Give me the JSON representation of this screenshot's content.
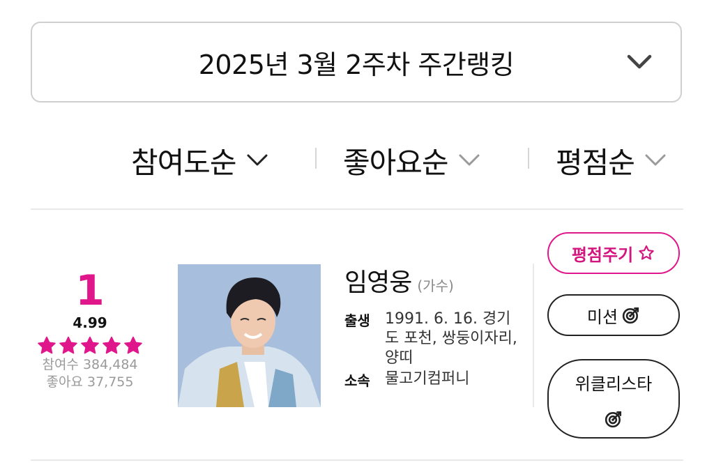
{
  "week_selector": {
    "label": "2025년 3월 2주차 주간랭킹"
  },
  "sort_options": [
    {
      "label": "참여도순",
      "active": true
    },
    {
      "label": "좋아요순",
      "active": false
    },
    {
      "label": "평점순",
      "active": false
    }
  ],
  "entry": {
    "rank": "1",
    "score": "4.99",
    "stars": 5,
    "participants": "참여수 384,484",
    "likes": "좋아요 37,755",
    "name": "임영웅",
    "job": "(가수)",
    "birth_label": "출생",
    "birth_value": "1991. 6. 16. 경기도 포천, 쌍둥이자리, 양띠",
    "agency_label": "소속",
    "agency_value": "물고기컴퍼니"
  },
  "buttons": {
    "rate": "평점주기",
    "mission": "미션",
    "weekly": "위클리스타"
  },
  "colors": {
    "accent": "#e0178b",
    "border": "#cfcfcf",
    "muted": "#9a9a9a"
  }
}
